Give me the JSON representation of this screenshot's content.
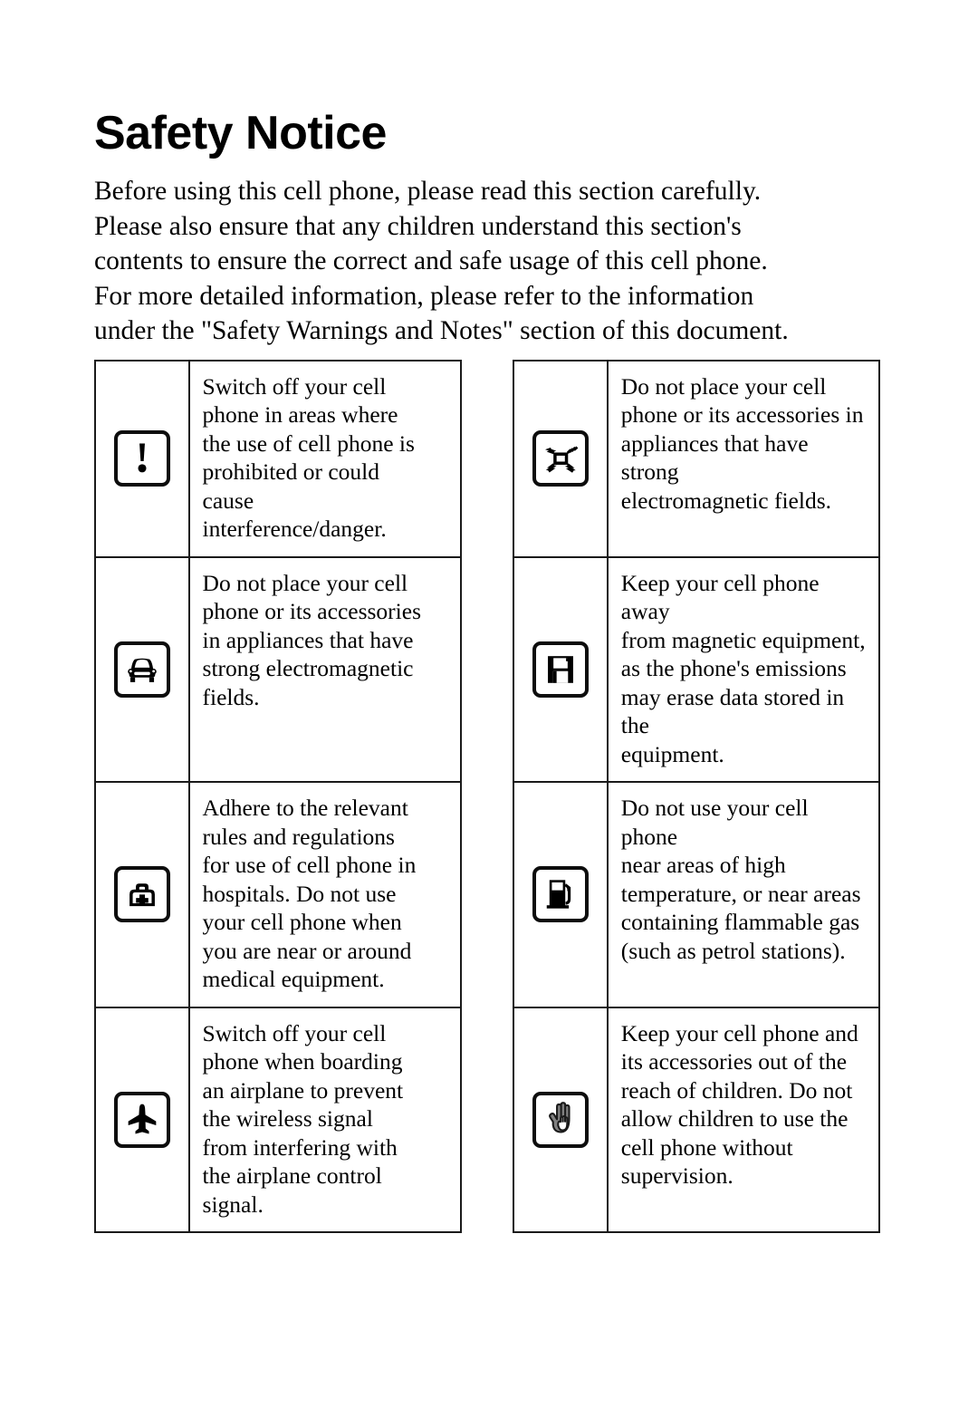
{
  "document": {
    "heading": "Safety Notice",
    "intro": "Before using this cell phone, please read this section carefully.\nPlease also ensure that any children understand this section's\ncontents to ensure the correct and safe usage of this cell phone.\nFor more detailed information, please refer to the information\nunder the \"Safety Warnings and Notes\" section of this document."
  },
  "colors": {
    "text": "#000000",
    "rule": "#1a1a1a",
    "background": "#ffffff",
    "icon_fill": "#000000",
    "hand_fill": "#808080"
  },
  "table": {
    "rows": [
      {
        "left": {
          "icon": "exclamation-mark-icon",
          "text": "Switch off your cell\nphone in areas where\nthe use of cell phone is\nprohibited or could\ncause\ninterference/danger."
        },
        "right": {
          "icon": "electromagnetic-field-icon",
          "text": "Do not place your cell\nphone or its accessories in\nappliances that have strong\nelectromagnetic fields."
        }
      },
      {
        "left": {
          "icon": "car-icon",
          "text": "Do not place your cell\nphone or its accessories\nin appliances that have\nstrong electromagnetic\nfields."
        },
        "right": {
          "icon": "floppy-disk-icon",
          "text": "Keep your cell phone away\nfrom magnetic equipment,\nas the phone's emissions\nmay erase data stored in the\nequipment."
        }
      },
      {
        "left": {
          "icon": "first-aid-kit-icon",
          "text": "Adhere to the relevant\nrules and regulations\nfor use of cell phone in\nhospitals. Do not use\nyour cell phone when\nyou are near or around\nmedical equipment."
        },
        "right": {
          "icon": "fuel-pump-icon",
          "text": "Do not use your cell phone\nnear areas of high\ntemperature, or near areas\ncontaining flammable gas\n(such as petrol stations)."
        }
      },
      {
        "left": {
          "icon": "airplane-icon",
          "text": "Switch off your cell\nphone when boarding\nan airplane to prevent\nthe wireless signal\nfrom interfering with\nthe airplane control\nsignal."
        },
        "right": {
          "icon": "stop-hand-icon",
          "text": "Keep your cell phone and\nits accessories out of the\nreach of children. Do not\nallow children to use the\ncell phone without\nsupervision."
        }
      }
    ]
  }
}
